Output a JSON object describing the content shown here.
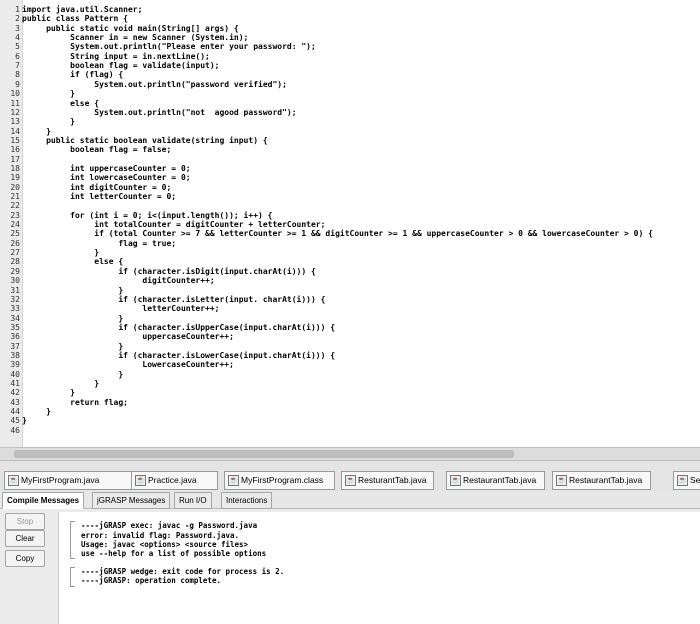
{
  "editor": {
    "lines": [
      {
        "n": "1",
        "text": "import java.util.Scanner;"
      },
      {
        "n": "2",
        "text": "public class Pattern {"
      },
      {
        "n": "3",
        "text": "     public static void main(String[] args) {"
      },
      {
        "n": "4",
        "text": "          Scanner in = new Scanner (System.in);"
      },
      {
        "n": "5",
        "text": "          System.out.println(\"Please enter your password: \");"
      },
      {
        "n": "6",
        "text": "          String input = in.nextLine();"
      },
      {
        "n": "7",
        "text": "          boolean flag = validate(input);"
      },
      {
        "n": "8",
        "text": "          if (flag) {"
      },
      {
        "n": "9",
        "text": "               System.out.println(\"password verified\");"
      },
      {
        "n": "10",
        "text": "          }"
      },
      {
        "n": "11",
        "text": "          else {"
      },
      {
        "n": "12",
        "text": "               System.out.println(\"not  agood password\");"
      },
      {
        "n": "13",
        "text": "          }"
      },
      {
        "n": "14",
        "text": "     }"
      },
      {
        "n": "15",
        "text": "     public static boolean validate(string input) {"
      },
      {
        "n": "16",
        "text": "          boolean flag = false;"
      },
      {
        "n": "17",
        "text": ""
      },
      {
        "n": "18",
        "text": "          int uppercaseCounter = 0;"
      },
      {
        "n": "19",
        "text": "          int lowercaseCounter = 0;"
      },
      {
        "n": "20",
        "text": "          int digitCounter = 0;"
      },
      {
        "n": "21",
        "text": "          int letterCounter = 0;"
      },
      {
        "n": "22",
        "text": ""
      },
      {
        "n": "23",
        "text": "          for (int i = 0; i<(input.length()); i++) {"
      },
      {
        "n": "24",
        "text": "               int totalCounter = digitCounter + letterCounter;"
      },
      {
        "n": "25",
        "text": "               if (total Counter >= 7 && letterCounter >= 1 && digitCounter >= 1 && uppercaseCounter > 0 && lowercaseCounter > 0) {"
      },
      {
        "n": "26",
        "text": "                    flag = true;"
      },
      {
        "n": "27",
        "text": "               }"
      },
      {
        "n": "28",
        "text": "               else {"
      },
      {
        "n": "29",
        "text": "                    if (character.isDigit(input.charAt(i))) {"
      },
      {
        "n": "30",
        "text": "                         digitCounter++;"
      },
      {
        "n": "31",
        "text": "                    }"
      },
      {
        "n": "32",
        "text": "                    if (character.isLetter(input. charAt(i))) {"
      },
      {
        "n": "33",
        "text": "                         letterCounter++;"
      },
      {
        "n": "34",
        "text": "                    }"
      },
      {
        "n": "35",
        "text": "                    if (character.isUpperCase(input.charAt(i))) {"
      },
      {
        "n": "36",
        "text": "                         uppercaseCounter++;"
      },
      {
        "n": "37",
        "text": "                    }"
      },
      {
        "n": "38",
        "text": "                    if (character.isLowerCase(input.charAt(i))) {"
      },
      {
        "n": "39",
        "text": "                         LowercaseCounter++;"
      },
      {
        "n": "40",
        "text": "                    }"
      },
      {
        "n": "41",
        "text": "               }"
      },
      {
        "n": "42",
        "text": "          }"
      },
      {
        "n": "43",
        "text": "          return flag;"
      },
      {
        "n": "44",
        "text": "     }"
      },
      {
        "n": "45",
        "text": "}"
      },
      {
        "n": "46",
        "text": ""
      }
    ]
  },
  "file_tabs": [
    {
      "label": "MyFirstProgram.java"
    },
    {
      "label": "Practice.java"
    },
    {
      "label": "MyFirstProgram.class"
    },
    {
      "label": "ResturantTab.java"
    },
    {
      "label": "RestaurantTab.java"
    },
    {
      "label": "RestaurantTab.java"
    },
    {
      "label": "Ses"
    }
  ],
  "message_tabs": [
    {
      "label": "Compile Messages",
      "active": true
    },
    {
      "label": "jGRASP Messages",
      "active": false
    },
    {
      "label": "Run I/O",
      "active": false
    },
    {
      "label": "Interactions",
      "active": false
    }
  ],
  "side_buttons": {
    "stop": "Stop",
    "clear": "Clear",
    "copy": "Copy"
  },
  "output": {
    "lines": [
      "----jGRASP exec: javac -g Password.java",
      "error: invalid flag: Password.java.",
      "Usage: javac <options> <source files>",
      "use --help for a list of possible options",
      "",
      "----jGRASP wedge: exit code for process is 2.",
      "----jGRASP: operation complete."
    ]
  }
}
